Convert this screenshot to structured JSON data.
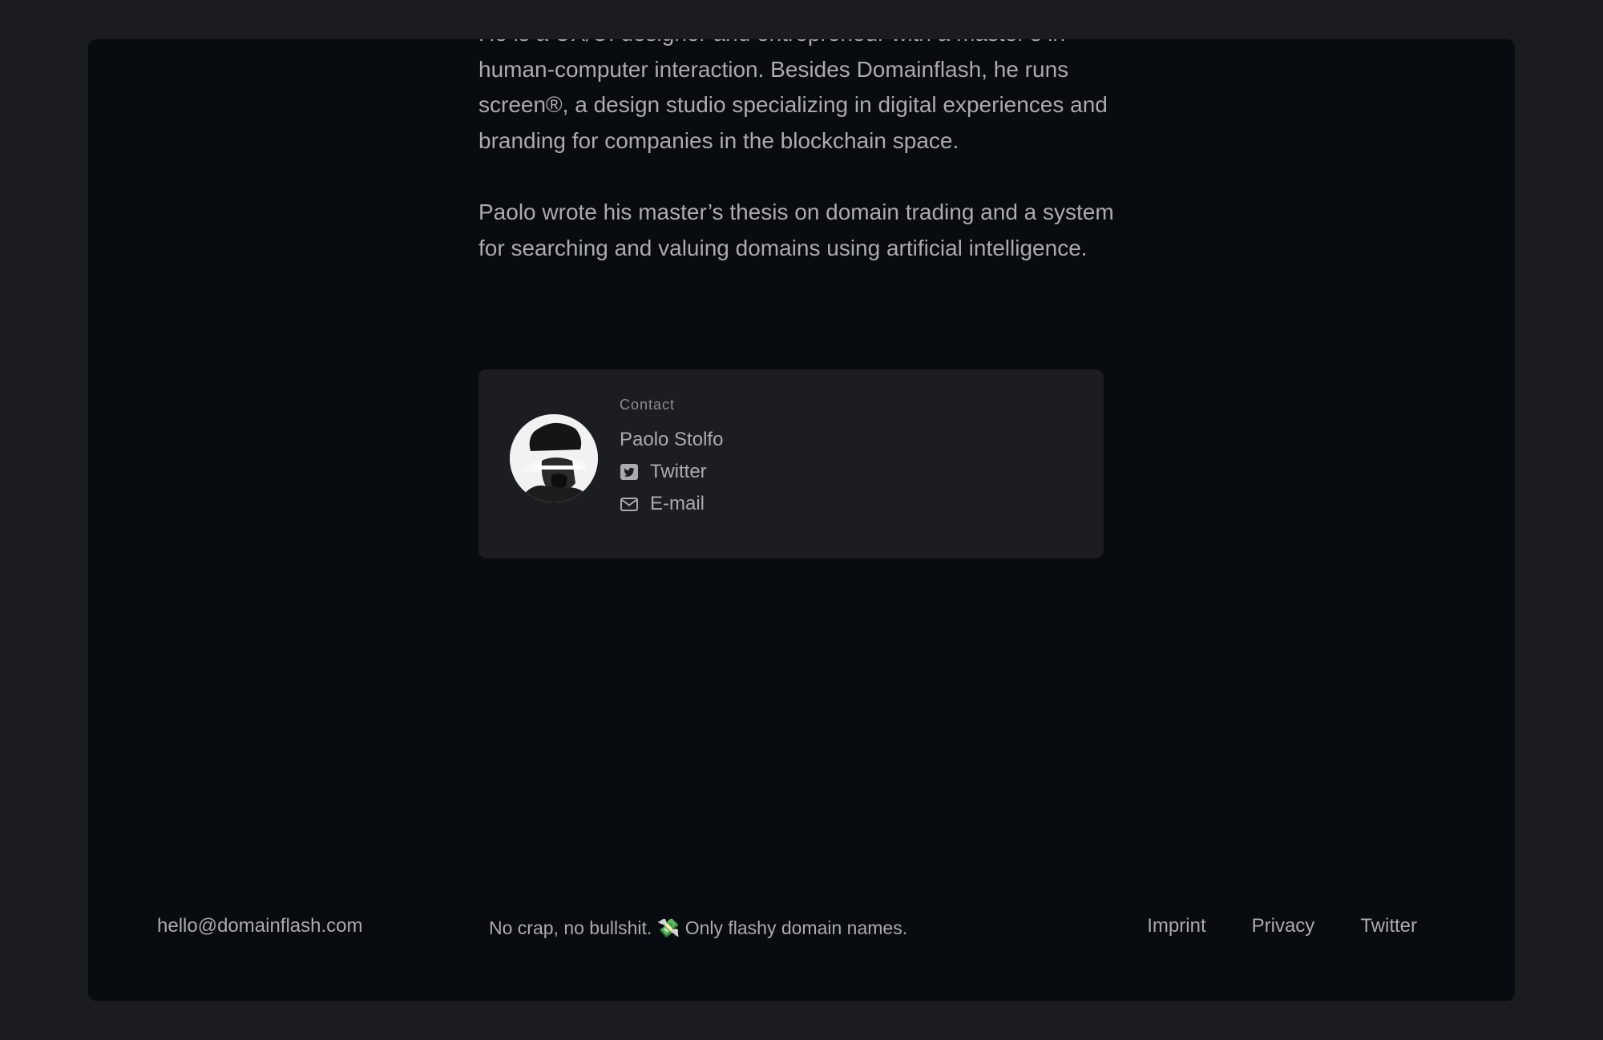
{
  "bio": {
    "paragraphs": [
      "He is a UX/UI designer and entrepreneur with a master’s in human-computer interaction. Besides Domainflash, he runs screen®, a design studio specializing in digital experiences and branding for companies in the blockchain space.",
      "Paolo wrote his master’s thesis on domain trading and a system for searching and valuing domains using artificial intelligence."
    ]
  },
  "contact": {
    "label": "Contact",
    "name": "Paolo Stolfo",
    "links": [
      {
        "label": "Twitter",
        "icon": "twitter-icon"
      },
      {
        "label": "E-mail",
        "icon": "mail-icon"
      }
    ]
  },
  "footer": {
    "email": "hello@domainflash.com",
    "tagline": "No crap, no bullshit. 💸 Only flashy domain names.",
    "nav": [
      "Imprint",
      "Privacy",
      "Twitter"
    ]
  }
}
